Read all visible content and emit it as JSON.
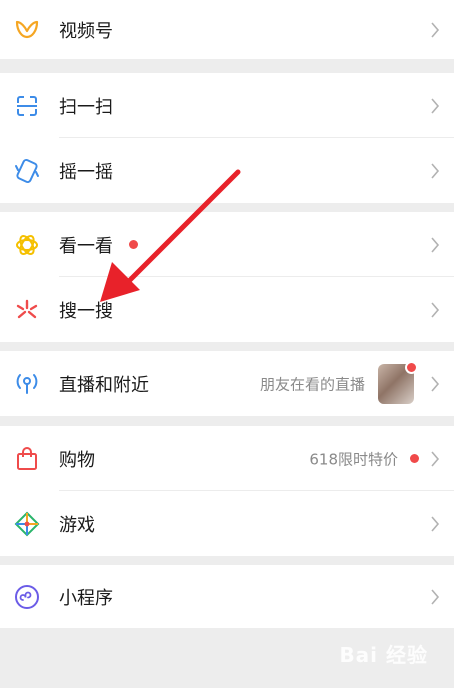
{
  "menu": {
    "channels": {
      "label": "视频号",
      "icon": "channels-butterfly-icon",
      "color": "#f5a623"
    },
    "scan": {
      "label": "扫一扫",
      "icon": "scan-icon",
      "color": "#3d8ce8"
    },
    "shake": {
      "label": "摇一摇",
      "icon": "shake-icon",
      "color": "#3d8ce8"
    },
    "top_stories": {
      "label": "看一看",
      "icon": "top-stories-icon",
      "color": "#f5c000",
      "has_badge": true
    },
    "search": {
      "label": "搜一搜",
      "icon": "search-star-icon",
      "color": "#ef4b4b"
    },
    "live_nearby": {
      "label": "直播和附近",
      "subtitle": "朋友在看的直播",
      "icon": "live-nearby-icon",
      "color": "#3d8ce8",
      "has_badge": true
    },
    "shopping": {
      "label": "购物",
      "subtitle": "618限时特价",
      "icon": "shopping-bag-icon",
      "color": "#ef4b4b",
      "has_badge": true
    },
    "games": {
      "label": "游戏",
      "icon": "games-icon",
      "color": "#2ab56b"
    },
    "mini_programs": {
      "label": "小程序",
      "icon": "mini-programs-icon",
      "color": "#6b5ce7"
    }
  },
  "watermark": "Bai 经验",
  "colors": {
    "background": "#ededed",
    "badge_red": "#f04a4a",
    "arrow_red": "#e8222a"
  }
}
